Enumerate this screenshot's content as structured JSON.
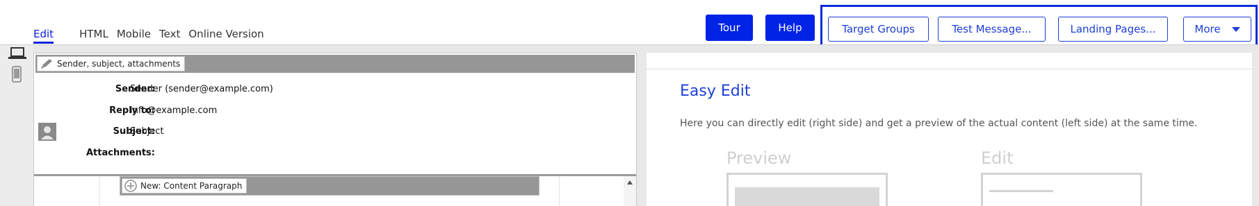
{
  "view_tabs": [
    {
      "label": "Edit",
      "active": true
    },
    {
      "label": "HTML",
      "active": false
    },
    {
      "label": "Mobile",
      "active": false
    },
    {
      "label": "Text",
      "active": false
    },
    {
      "label": "Online Version",
      "active": false
    }
  ],
  "toolbar": {
    "tour_label": "Tour",
    "help_label": "Help",
    "actions": {
      "target_groups": "Target Groups",
      "test_message": "Test Message...",
      "landing_pages": "Landing Pages...",
      "more": "More"
    }
  },
  "device_bar": {
    "icons": [
      "laptop-icon",
      "mobile-icon"
    ]
  },
  "editor": {
    "section_label": "Sender, subject, attachments",
    "fields": {
      "sender_label": "Sender:",
      "sender_value": "Sender (sender@example.com)",
      "reply_label": "Reply to:",
      "reply_value": "info@example.com",
      "subject_label": "Subject:",
      "subject_value": "Subject",
      "attachments_label": "Attachments:"
    },
    "new_paragraph_label": "New: Content Paragraph"
  },
  "preview": {
    "title": "Easy Edit",
    "description": "Here you can directly edit (right side) and get a preview of the actual content (left side) at the same time.",
    "preview_label": "Preview",
    "edit_label": "Edit"
  },
  "colors": {
    "accent": "#0023e6",
    "link_blue": "#1d3fd6",
    "bar_gray": "#969696"
  }
}
